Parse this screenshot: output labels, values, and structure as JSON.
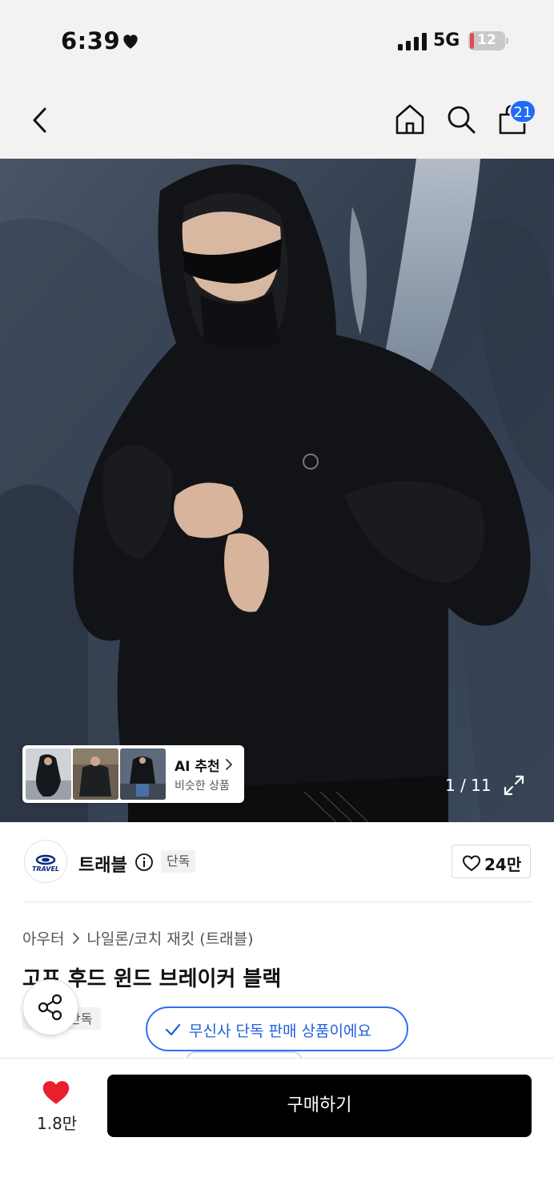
{
  "status_bar": {
    "time": "6:39",
    "network": "5G",
    "battery": "12",
    "battery_level_percent": 12
  },
  "header": {
    "cart_badge": "21",
    "icons": [
      "back-icon",
      "home-icon",
      "search-icon",
      "shopping-bag-icon"
    ]
  },
  "gallery": {
    "counter": "1 / 11",
    "ai_recommend": {
      "title": "AI 추천",
      "subtitle": "비슷한 상품"
    }
  },
  "brand": {
    "logo_text": "TRAVEL",
    "name": "트래블",
    "tag": "단독",
    "likes": "24만"
  },
  "product": {
    "breadcrumb": [
      "아우터",
      "나일론/코치 재킷 (트래블)"
    ],
    "title": "고프 후드 윈드 브레이커 블랙",
    "tag": "단독",
    "exclusive_notice": "무신사 단독 판매 상품이에요"
  },
  "bottom_bar": {
    "wish_count": "1.8만",
    "buy_label": "구매하기"
  },
  "colors": {
    "accent_blue": "#1f6cf5",
    "wish_red": "#e8202e",
    "buy_black": "#000000"
  }
}
